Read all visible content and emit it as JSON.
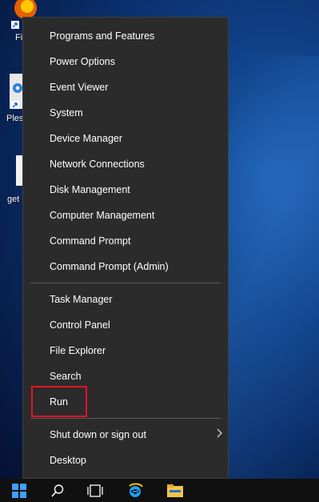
{
  "desktop": {
    "icons": [
      {
        "label": "Fi",
        "icon": "firefox-icon"
      },
      {
        "label": "Ples",
        "icon": "plesk-icon"
      },
      {
        "label": "get",
        "icon": "file-icon"
      }
    ]
  },
  "menu": {
    "group1": [
      "Programs and Features",
      "Power Options",
      "Event Viewer",
      "System",
      "Device Manager",
      "Network Connections",
      "Disk Management",
      "Computer Management",
      "Command Prompt",
      "Command Prompt (Admin)"
    ],
    "group2": [
      "Task Manager",
      "Control Panel",
      "File Explorer",
      "Search",
      "Run"
    ],
    "group3": [
      "Shut down or sign out",
      "Desktop"
    ]
  },
  "taskbar": {
    "icons": [
      "windows-start-icon",
      "search-icon",
      "task-view-icon",
      "internet-explorer-icon",
      "file-explorer-icon"
    ]
  },
  "colors": {
    "menu_bg": "#2b2b2b",
    "highlight_border": "#e81123",
    "taskbar_bg": "#101010"
  }
}
